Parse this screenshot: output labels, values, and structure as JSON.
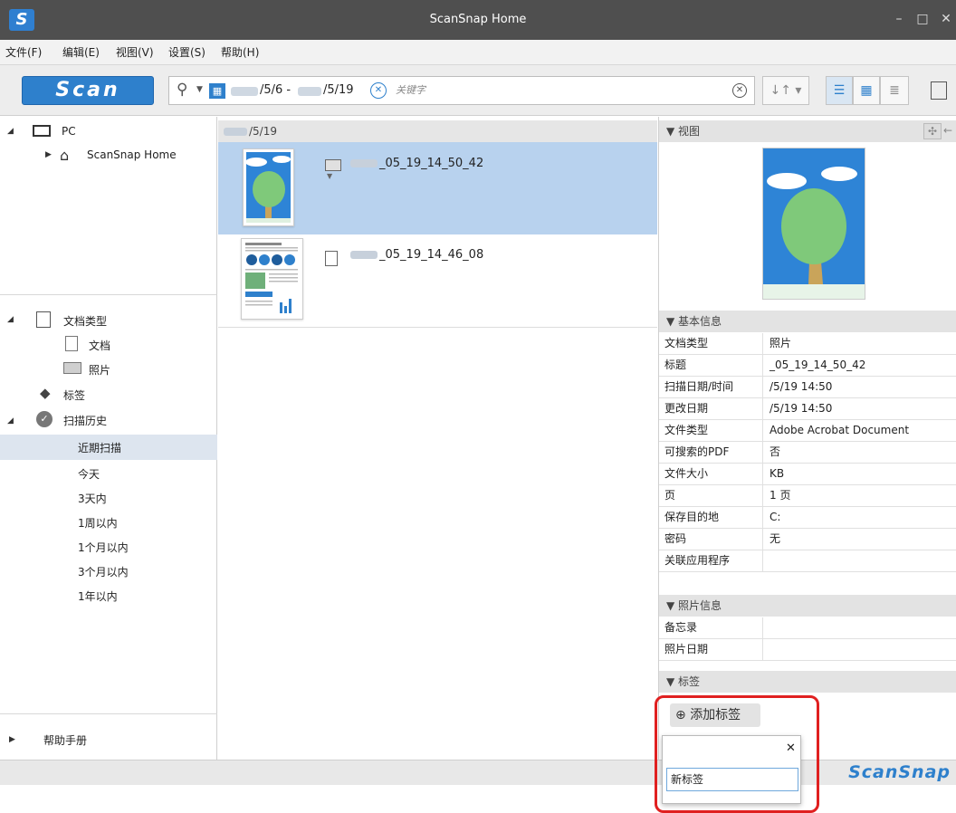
{
  "app": {
    "title": "ScanSnap Home",
    "brand": "ScanSnap",
    "logo_letter": "S"
  },
  "window_controls": {
    "minimize": "–",
    "maximize": "□",
    "close": "✕"
  },
  "menu": [
    "文件(F)",
    "编辑(E)",
    "视图(V)",
    "设置(S)",
    "帮助(H)"
  ],
  "toolbar": {
    "scan_label": "Scan",
    "date_from": "/5/6 -",
    "date_to": "/5/19",
    "keyword_placeholder": "关键字"
  },
  "left_tree": {
    "pc_label": "PC",
    "scansnap_home_label": "ScanSnap Home",
    "doc_type_label": "文档类型",
    "doc_label": "文档",
    "photo_label": "照片",
    "tag_label": "标签",
    "history_label": "扫描历史",
    "history_items": [
      "近期扫描",
      "今天",
      "3天内",
      "1周以内",
      "1个月以内",
      "3个月以内",
      "1年以内"
    ],
    "help_label": "帮助手册"
  },
  "content": {
    "date_header": "/5/19",
    "files": [
      {
        "name": "_05_19_14_50_42",
        "kind": "photo",
        "selected": true
      },
      {
        "name": "_05_19_14_46_08",
        "kind": "document",
        "selected": false
      }
    ]
  },
  "right_panel": {
    "view_header": "▼ 视图",
    "basic_header": "▼ 基本信息",
    "props": [
      {
        "k": "文档类型",
        "v": "照片"
      },
      {
        "k": "标题",
        "v": "_05_19_14_50_42"
      },
      {
        "k": "扫描日期/时间",
        "v": "/5/19 14:50"
      },
      {
        "k": "更改日期",
        "v": "/5/19 14:50"
      },
      {
        "k": "文件类型",
        "v": "Adobe Acrobat Document"
      },
      {
        "k": "可搜索的PDF",
        "v": "否"
      },
      {
        "k": "文件大小",
        "v": "KB"
      },
      {
        "k": "页",
        "v": "1 页"
      },
      {
        "k": "保存目的地",
        "v": "C:"
      },
      {
        "k": "密码",
        "v": "无"
      },
      {
        "k": "关联应用程序",
        "v": ""
      }
    ],
    "photo_header": "▼ 照片信息",
    "photo_props": [
      {
        "k": "备忘录",
        "v": ""
      },
      {
        "k": "照片日期",
        "v": ""
      }
    ],
    "tag_header": "▼ 标签",
    "add_tag_label": "添加标签"
  },
  "tag_popup": {
    "close": "✕",
    "input_value": "新标签"
  },
  "colors": {
    "accent": "#2e80cc",
    "selection": "#b8d2ee",
    "titlebar": "#4f4f4f",
    "highlight": "#e02020"
  }
}
